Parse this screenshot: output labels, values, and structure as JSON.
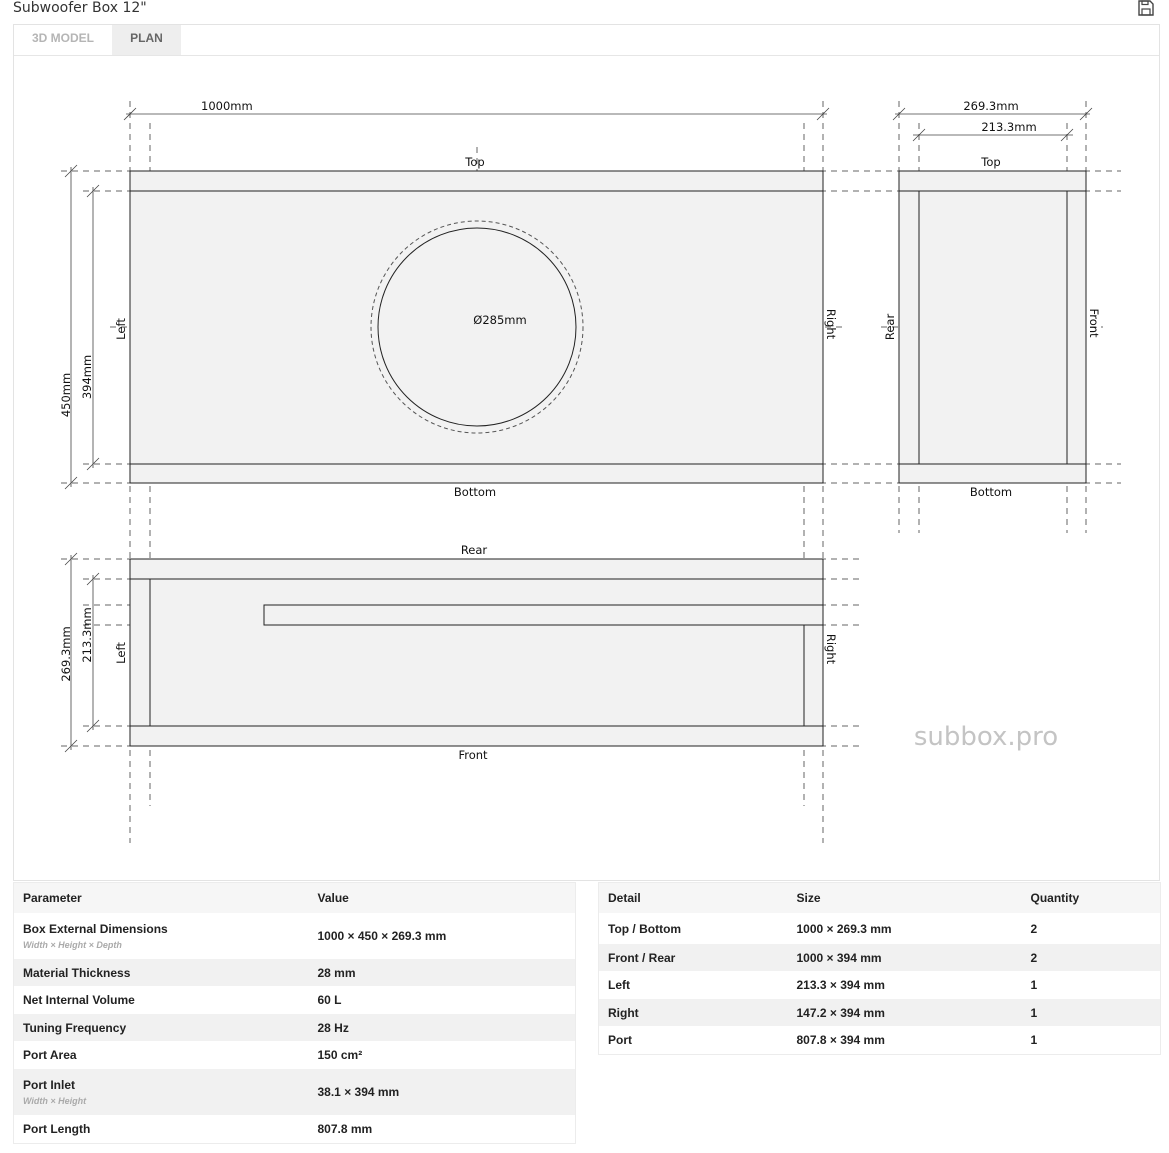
{
  "window": {
    "title": "Subwoofer Box 12\""
  },
  "tabs": [
    {
      "label": "3D MODEL",
      "active": false
    },
    {
      "label": "PLAN",
      "active": true
    }
  ],
  "plan": {
    "front_view": {
      "width_dim": "1000mm",
      "height_dim": "450mm",
      "inner_height_dim": "394mm",
      "hole_dim": "Ø285mm",
      "label_top": "Top",
      "label_bottom": "Bottom",
      "label_left": "Left",
      "label_right": "Right"
    },
    "side_view": {
      "depth_dim": "269.3mm",
      "inner_depth_dim": "213.3mm",
      "label_top": "Top",
      "label_bottom": "Bottom",
      "label_rear": "Rear",
      "label_front": "Front"
    },
    "top_view": {
      "depth_dim": "269.3mm",
      "inner_depth_dim": "213.3mm",
      "label_rear": "Rear",
      "label_front": "Front",
      "label_left": "Left",
      "label_right": "Right"
    },
    "watermark": "subbox.pro"
  },
  "params_table": {
    "headers": [
      "Parameter",
      "Value"
    ],
    "rows": [
      {
        "param": "Box External Dimensions",
        "note": "Width × Height × Depth",
        "value": "1000 × 450 × 269.3 mm"
      },
      {
        "param": "Material Thickness",
        "note": "",
        "value": "28 mm"
      },
      {
        "param": "Net Internal Volume",
        "note": "",
        "value": "60 L"
      },
      {
        "param": "Tuning Frequency",
        "note": "",
        "value": "28 Hz"
      },
      {
        "param": "Port Area",
        "note": "",
        "value": "150 cm²"
      },
      {
        "param": "Port Inlet",
        "note": "Width × Height",
        "value": "38.1 × 394 mm"
      },
      {
        "param": "Port Length",
        "note": "",
        "value": "807.8 mm"
      }
    ]
  },
  "details_table": {
    "headers": [
      "Detail",
      "Size",
      "Quantity"
    ],
    "rows": [
      {
        "detail": "Top / Bottom",
        "size": "1000 × 269.3 mm",
        "qty": "2"
      },
      {
        "detail": "Front / Rear",
        "size": "1000 × 394 mm",
        "qty": "2"
      },
      {
        "detail": "Left",
        "size": "213.3 × 394 mm",
        "qty": "1"
      },
      {
        "detail": "Right",
        "size": "147.2 × 394 mm",
        "qty": "1"
      },
      {
        "detail": "Port",
        "size": "807.8 × 394 mm",
        "qty": "1"
      }
    ]
  },
  "icons": {
    "save": "save-icon"
  }
}
